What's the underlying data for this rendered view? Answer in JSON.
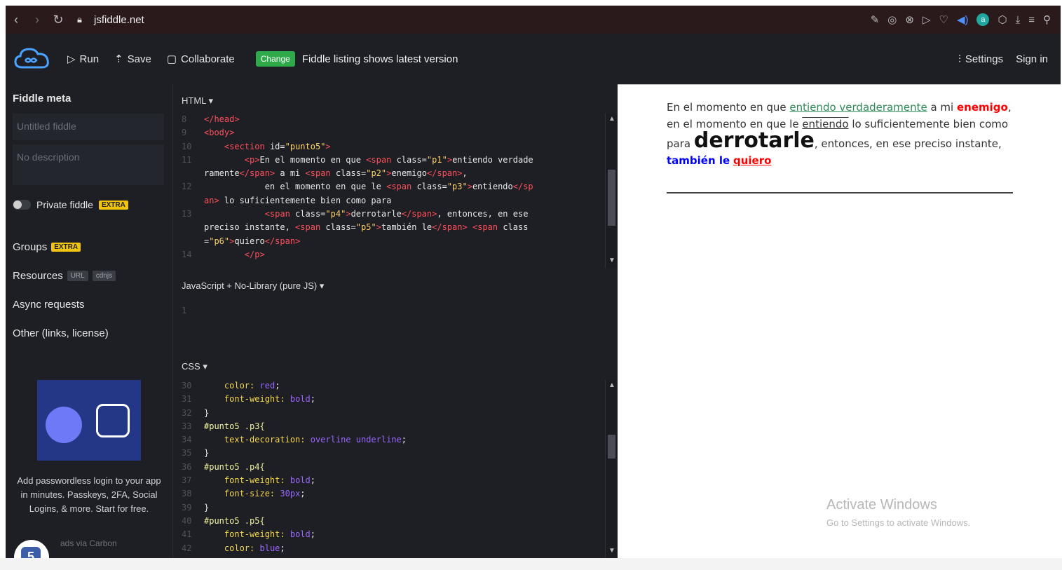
{
  "browser": {
    "url": "jsfiddle.net",
    "account_initial": "a"
  },
  "toolbar": {
    "run_label": "Run",
    "save_label": "Save",
    "collaborate_label": "Collaborate",
    "change_badge": "Change",
    "notice": "Fiddle listing shows latest version",
    "settings_label": "Settings",
    "signin_label": "Sign in"
  },
  "sidebar": {
    "meta_title": "Fiddle meta",
    "title_placeholder": "Untitled fiddle",
    "description_placeholder": "No description",
    "private_label": "Private fiddle",
    "extra_badge": "EXTRA",
    "groups_label": "Groups",
    "resources_label": "Resources",
    "url_tag": "URL",
    "cdnjs_tag": "cdnjs",
    "async_label": "Async requests",
    "other_label": "Other (links, license)",
    "ad_text": "Add passwordless login to your app in minutes. Passkeys, 2FA, Social Logins, & more. Start for free.",
    "ad_via": "ads via Carbon",
    "badge_number": "5"
  },
  "editors": {
    "html_label": "HTML ▾",
    "js_label": "JavaScript + No-Library (pure JS) ▾",
    "css_label": "CSS ▾"
  },
  "result": {
    "t1": "En el momento en que ",
    "p1": "entiendo verdaderamente",
    "t2": " a mi ",
    "p2": "enemigo",
    "t3": ", en el momento en que le ",
    "p3": "entiendo",
    "t4": " lo suficientemente bien como para ",
    "p4": "derrotarle",
    "t5": ", entonces, en ese preciso instante, ",
    "p5": "también le",
    "t6": " ",
    "p6": "quiero"
  },
  "watermark": {
    "line1": "Activate Windows",
    "line2": "Go to Settings to activate Windows."
  },
  "colors": {
    "topbar": "#1d1f25",
    "browserbar": "#2a1a1c",
    "change_green": "#2faa4a",
    "extra_yellow": "#f1c40f",
    "code_tag": "#ff4f5a",
    "code_value": "#9a66ff"
  }
}
